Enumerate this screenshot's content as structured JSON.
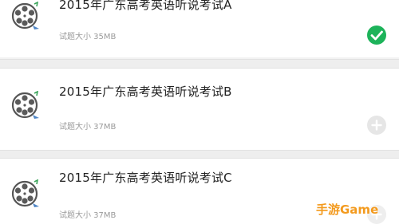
{
  "items": [
    {
      "title": "2015年广东高考英语听说考试A",
      "size": "试题大小 35MB",
      "status": "downloaded",
      "icon": "film-reel-icon",
      "status_icon": "check-circle-icon"
    },
    {
      "title": "2015年广东高考英语听说考试B",
      "size": "试题大小 37MB",
      "status": "not-downloaded",
      "icon": "film-reel-icon",
      "status_icon": "plus-circle-icon"
    },
    {
      "title": "2015年广东高考英语听说考试C",
      "size": "试题大小 37MB",
      "status": "not-downloaded",
      "icon": "film-reel-icon",
      "status_icon": "plus-circle-icon"
    }
  ],
  "watermark": "手游Game",
  "colors": {
    "background": "#f2f2f2",
    "card": "#ffffff",
    "title_text": "#222222",
    "size_text": "#9a9a9a",
    "check_green": "#1db35a",
    "add_gray": "#e6e6e6",
    "watermark": "#f39a1e"
  }
}
